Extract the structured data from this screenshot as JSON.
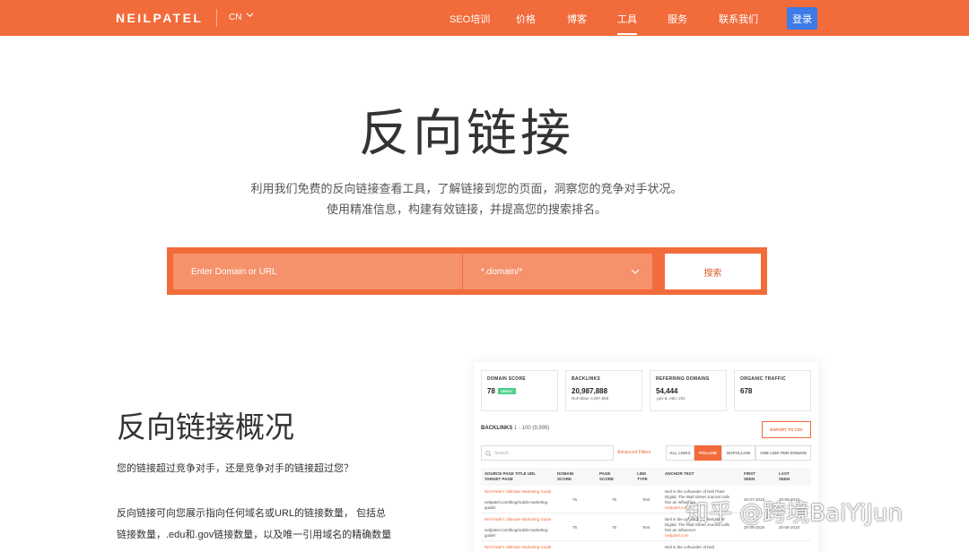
{
  "header": {
    "logo": "NEILPATEL",
    "lang": "CN",
    "nav": [
      "SEO培训",
      "价格",
      "博客",
      "工具",
      "服务",
      "联系我们"
    ],
    "active_nav": "工具",
    "login": "登录"
  },
  "hero": {
    "title": "反向链接",
    "subtitle_lines": [
      "利用我们免费的反向链接查看工具，了解链接到您的页面，洞察您的竞争对手状况。",
      "使用精准信息，构建有效链接，并提高您的搜索排名。"
    ]
  },
  "search": {
    "placeholder": "Enter Domain or URL",
    "select_value": "*.domain/*",
    "button": "搜索"
  },
  "overview": {
    "title": "反向链接概况",
    "question": "您的链接超过竞争对手，还是竞争对手的链接超过您？",
    "paragraph": "反向链接可向您展示指向任何域名或URL的链接数量， 包括总链接数量，.edu和.gov链接数量，以及唯一引用域名的精确数量"
  },
  "dashboard": {
    "cards": [
      {
        "label": "DOMAIN SCORE",
        "value": "78",
        "badge": "GREAT",
        "sub": ""
      },
      {
        "label": "BACKLINKS",
        "value": "20,987,888",
        "badge": "",
        "sub": "NoFollow: 4,987,555"
      },
      {
        "label": "REFERRING DOMAINS",
        "value": "54,444",
        "badge": "",
        "sub": ".gov & .edu: 234"
      },
      {
        "label": "ORGANIC TRAFFIC",
        "value": "678",
        "badge": "",
        "sub": ""
      }
    ],
    "backlinks_title": "BACKLINKS",
    "backlinks_range": "1 - 100 (9,999)",
    "export": "EXPORT TO CSV",
    "search_placeholder": "Search",
    "advanced_filters": "Advanced Filters",
    "filter_tabs": [
      "ALL LINKS",
      "FOLLOW",
      "NOFOLLOW",
      "ONE LINK PER DOMAIN"
    ],
    "active_filter": "FOLLOW",
    "columns": [
      "SOURCE PAGE TITLE URL TARGET PAGE",
      "DOMAIN SCORE",
      "PAGE SCORE",
      "LINK TYPE",
      "ANCHOR TEXT",
      "FIRST SEEN",
      "LAST SEEN"
    ],
    "rows": [
      {
        "title": "Neil Patel's Ultimate Marketing Guide",
        "url": "neilpatel.com/blog/reddit-marketing-guide/",
        "domain_score": "76",
        "page_score": "76",
        "link_type": "Text",
        "anchor": "Neil is the cofounder of Neil Patel Digital. The Wall Street Journal calls him an influencer",
        "anchor_link": "neilpatel.com",
        "first_seen": "20-07-2018",
        "last_seen": "20-09-2018"
      },
      {
        "title": "Neil Patel's Ultimate Marketing Guide",
        "url": "neilpatel.com/blog/reddit-marketing-guide/",
        "domain_score": "76",
        "page_score": "76",
        "link_type": "Text",
        "anchor": "Neil is the cofounder of Neil Patel Digital. The Wall Street Journal calls him an influencer",
        "anchor_link": "neilpatel.com",
        "first_seen": "20-09-2018",
        "last_seen": "20-09-2018"
      },
      {
        "title": "Neil Patel's Ultimate Marketing Guide",
        "url": "",
        "domain_score": "",
        "page_score": "",
        "link_type": "",
        "anchor": "Neil is the cofounder of Neil",
        "anchor_link": "",
        "first_seen": "",
        "last_seen": ""
      }
    ]
  },
  "watermark": "知乎 @跨境BaiYiJun"
}
